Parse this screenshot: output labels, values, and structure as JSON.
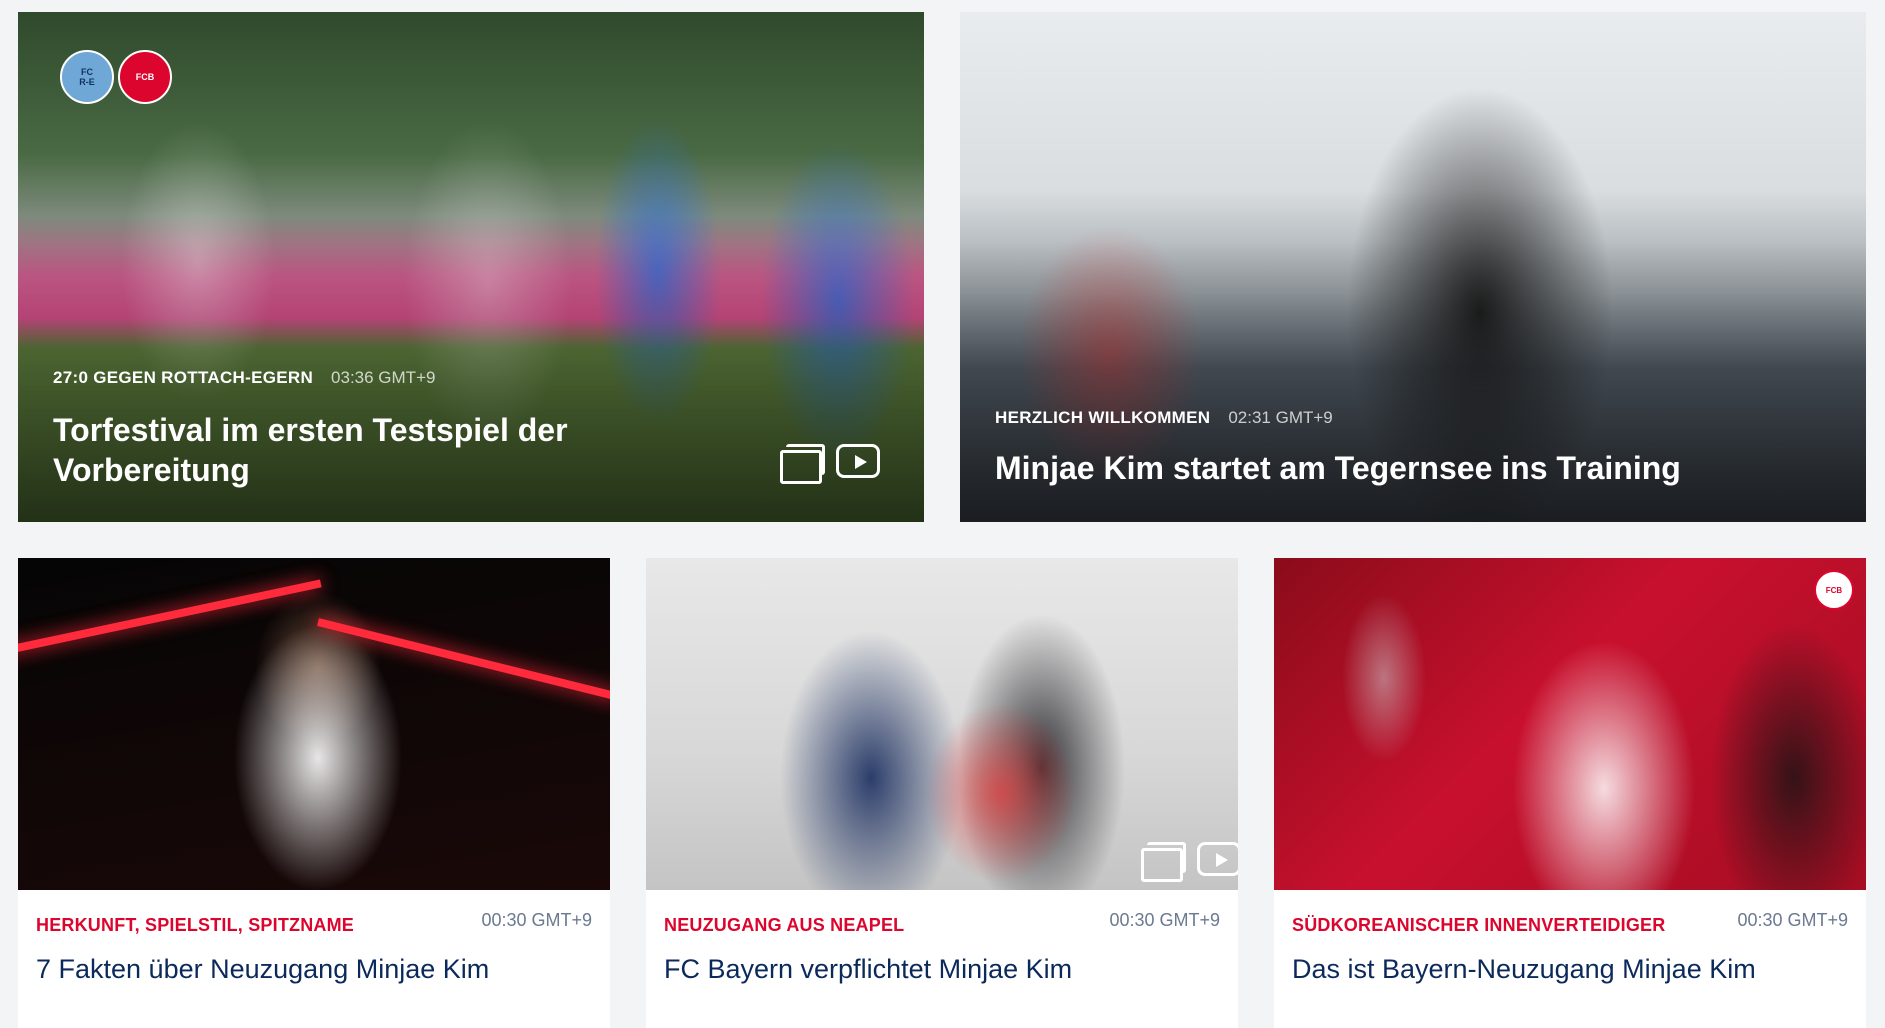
{
  "heroes": [
    {
      "tag": "27:0 GEGEN ROTTACH-EGERN",
      "time": "03:36 GMT+9",
      "title": "Torfestival im ersten Testspiel der Vorbereitung",
      "badges": [
        "FC ROTTACH",
        "FC BAYERN MÜNCHEN"
      ],
      "icons": [
        "gallery-icon",
        "play-icon"
      ]
    },
    {
      "tag": "HERZLICH WILLKOMMEN",
      "time": "02:31 GMT+9",
      "title": "Minjae Kim startet am Tegernsee ins Training"
    }
  ],
  "cards": [
    {
      "tag": "HERKUNFT, SPIELSTIL, SPITZNAME",
      "time": "00:30 GMT+9",
      "title": "7 Fakten über Neuzugang Minjae Kim"
    },
    {
      "tag": "NEUZUGANG AUS NEAPEL",
      "time": "00:30 GMT+9",
      "title": "FC Bayern verpflichtet Minjae Kim",
      "icons": [
        "gallery-icon",
        "play-icon"
      ]
    },
    {
      "tag": "SÜDKOREANISCHER INNENVERTEIDIGER",
      "time": "00:30 GMT+9",
      "title": "Das ist Bayern-Neuzugang Minjae Kim"
    }
  ],
  "colors": {
    "accent_red": "#dc052d",
    "title_navy": "#0b2a5b",
    "time_gray": "#6b7a90",
    "page_bg": "#f3f4f6"
  }
}
